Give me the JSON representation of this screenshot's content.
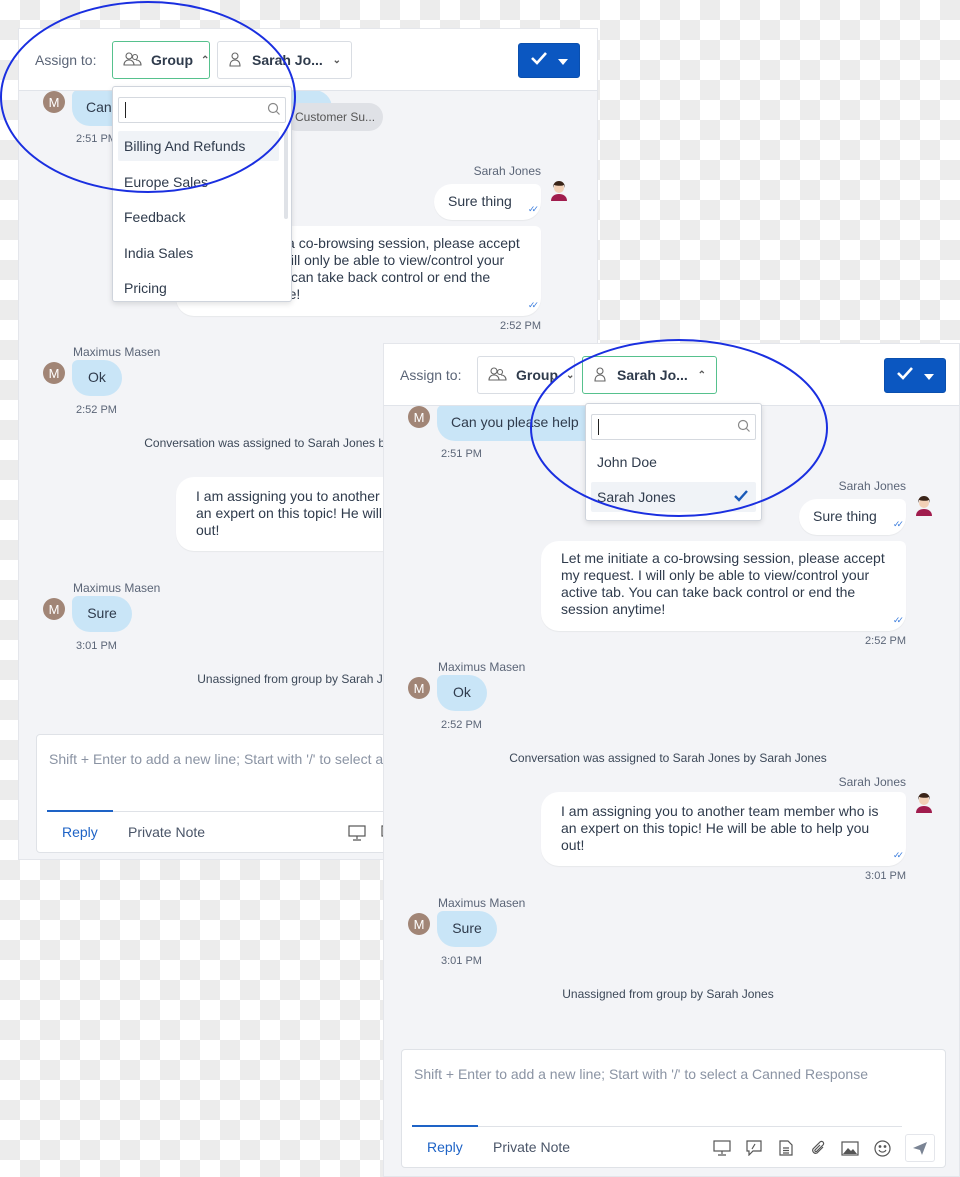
{
  "left_panel": {
    "header": {
      "assign_label": "Assign to:",
      "group_label": "Group",
      "agent_label": "Sarah Jo..."
    },
    "group_dropdown": {
      "search_value": "",
      "items": [
        "Billing And Refunds",
        "Europe Sales",
        "Feedback",
        "India Sales",
        "Pricing"
      ],
      "highlighted": "Billing And Refunds"
    }
  },
  "right_panel": {
    "header": {
      "assign_label": "Assign to:",
      "group_label": "Group",
      "agent_label": "Sarah Jo..."
    },
    "agent_dropdown": {
      "search_value": "",
      "items": [
        "John Doe",
        "Sarah Jones"
      ],
      "selected": "Sarah Jones"
    }
  },
  "conversation": {
    "assign_pill": "Customer Su...",
    "messages": [
      {
        "sender": "Maximus Masen",
        "avatar": "M",
        "text": "Can you please help",
        "time": "2:51 PM"
      },
      {
        "sender": "Sarah Jones",
        "text": "Sure thing"
      },
      {
        "sender": "Sarah Jones",
        "text": "Let me initiate a co-browsing session, please accept my request. I will only be able to view/control your active tab. You can take back control or end the session anytime!",
        "time": "2:52 PM"
      },
      {
        "sender": "Maximus Masen",
        "avatar": "M",
        "text": "Ok",
        "time": "2:52 PM"
      },
      {
        "system": "Conversation was assigned to Sarah Jones by Sarah Jones"
      },
      {
        "sender": "Sarah Jones",
        "text": "I am assigning you to another team member who is an expert on this topic! He will be able to help you out!",
        "time": "3:01 PM"
      },
      {
        "sender": "Maximus Masen",
        "avatar": "M",
        "text": "Sure",
        "time": "3:01 PM"
      },
      {
        "system": "Unassigned from group by Sarah Jones"
      }
    ]
  },
  "composer": {
    "placeholder": "Shift + Enter to add a new line; Start with '/' to select a Canned Response",
    "tabs": [
      "Reply",
      "Private Note"
    ],
    "active_tab": "Reply",
    "tools": [
      "screen-share-icon",
      "canned-response-icon",
      "article-icon",
      "attachment-icon",
      "image-icon",
      "emoji-icon",
      "send-icon"
    ]
  },
  "colors": {
    "accent": "#0b57c1",
    "open_select_border": "#56c18d",
    "customer_bubble": "#c9e5f7",
    "annotation": "#1a2fe0"
  }
}
